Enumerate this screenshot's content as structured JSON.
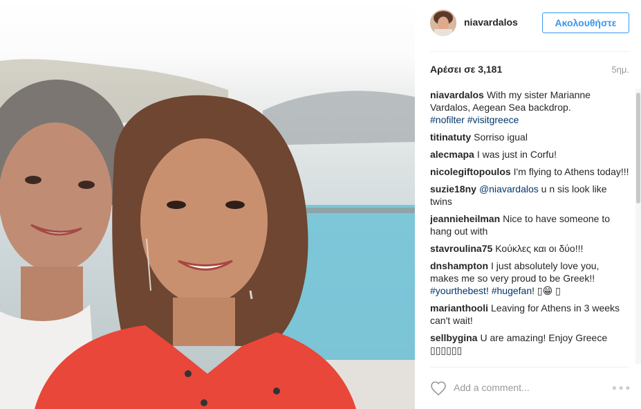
{
  "post": {
    "username": "niavardalos",
    "follow_label": "Ακολουθήστε",
    "likes_label": "Αρέσει σε",
    "likes_count": "3,181",
    "time_ago": "5ημ.",
    "add_comment_placeholder": "Add a comment...",
    "more_label": "∘∘∘"
  },
  "comments": [
    {
      "user": "niavardalos",
      "text": "With my sister Marianne Vardalos, Aegean Sea backdrop.",
      "tags": [
        "#nofilter",
        "#visitgreece"
      ]
    },
    {
      "user": "titinatuty",
      "text": "Sorriso igual"
    },
    {
      "user": "alecmapa",
      "text": "I was just in Corfu!"
    },
    {
      "user": "nicolegiftopoulos",
      "text": "I'm flying to Athens today!!!"
    },
    {
      "user": "suzie18ny",
      "mention": "@niavardalos",
      "text": "u n sis look like twins"
    },
    {
      "user": "jeannieheilman",
      "text": "Nice to have someone to hang out with"
    },
    {
      "user": "stavroulina75",
      "text": "Κούκλες και οι δύο!!!"
    },
    {
      "user": "dnshampton",
      "text": "I just absolutely love you, makes me so very proud to be Greek!!",
      "tags": [
        "#yourthebest",
        "#hugefan"
      ],
      "tail": "! ▯😁 ▯"
    },
    {
      "user": "marianthooli",
      "text": "Leaving for Athens in 3 weeks can't wait!"
    },
    {
      "user": "sellbygina",
      "text": "U are amazing! Enjoy Greece ▯▯▯▯▯▯"
    }
  ],
  "colors": {
    "accent": "#3897f0",
    "hashtag": "#003569",
    "muted": "#999999",
    "text": "#262626"
  },
  "icons": {
    "like": "heart-icon",
    "options": "more-options-icon"
  }
}
